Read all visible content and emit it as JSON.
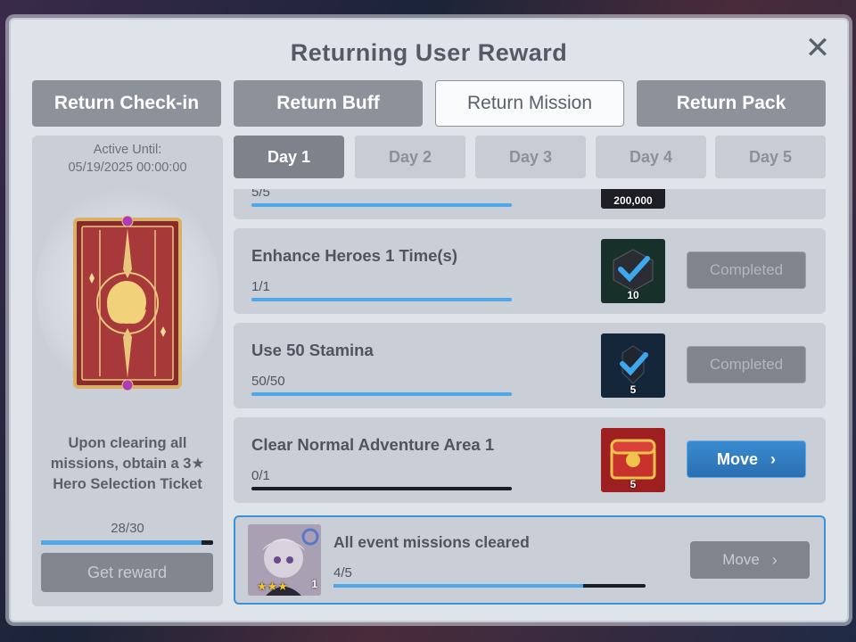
{
  "dialog": {
    "title": "Returning User Reward",
    "close_icon": "close-icon"
  },
  "tabs": [
    {
      "label": "Return Check-in",
      "active": false
    },
    {
      "label": "Return Buff",
      "active": false
    },
    {
      "label": "Return Mission",
      "active": true
    },
    {
      "label": "Return Pack",
      "active": false
    }
  ],
  "side": {
    "active_label": "Active Until:",
    "active_date": "05/19/2025 00:00:00",
    "description_lines": [
      "Upon clearing all",
      "missions, obtain a 3★",
      "Hero Selection Ticket"
    ],
    "progress_text": "28/30",
    "progress_fraction": 0.933,
    "button_label": "Get reward"
  },
  "days": [
    {
      "label": "Day 1",
      "active": true
    },
    {
      "label": "Day 2",
      "active": false
    },
    {
      "label": "Day 3",
      "active": false
    },
    {
      "label": "Day 4",
      "active": false
    },
    {
      "label": "Day 5",
      "active": false
    }
  ],
  "missions": [
    {
      "title": "",
      "progress": "5/5",
      "fraction": 1.0,
      "reward_count": "200,000",
      "reward_icon": "gold-coin-icon",
      "button": ""
    },
    {
      "title": "Enhance Heroes 1 Time(s)",
      "progress": "1/1",
      "fraction": 1.0,
      "reward_count": "10",
      "reward_icon": "enhance-book-icon",
      "button": "Completed"
    },
    {
      "title": "Use 50 Stamina",
      "progress": "50/50",
      "fraction": 1.0,
      "reward_count": "5",
      "reward_icon": "stamina-item-icon",
      "button": "Completed"
    },
    {
      "title": "Clear Normal Adventure Area 1",
      "progress": "0/1",
      "fraction": 0.0,
      "reward_count": "5",
      "reward_icon": "treasure-chest-icon",
      "button": "Move"
    }
  ],
  "final": {
    "title": "All event missions cleared",
    "progress": "4/5",
    "fraction": 0.8,
    "avatar_count": "1",
    "avatar_stars": "★★★",
    "button": "Move"
  },
  "colors": {
    "accent": "#3d8fd6",
    "bar_fill": "#4ea7e6",
    "panel": "#dfe3ea"
  }
}
